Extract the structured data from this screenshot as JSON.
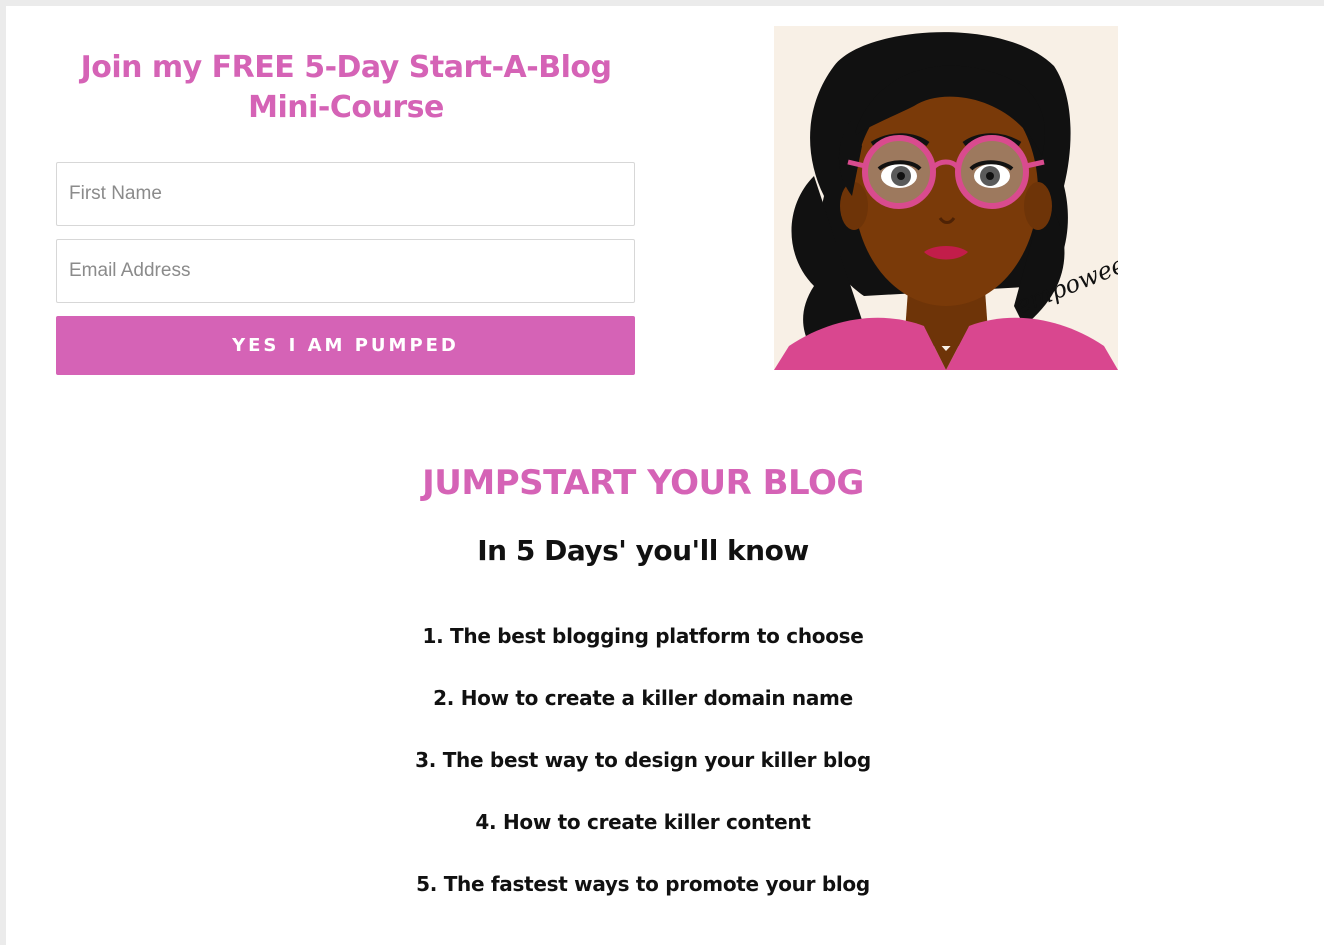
{
  "signup": {
    "title": "Join my FREE 5-Day Start-A-Blog Mini-Course",
    "first_name_placeholder": "First Name",
    "first_name_value": "",
    "email_placeholder": "Email Address",
    "email_value": "",
    "submit_label": "YES I AM PUMPED"
  },
  "avatar": {
    "signature": "empowee",
    "icon": "woman-with-pink-glasses-illustration"
  },
  "content": {
    "heading": "JUMPSTART YOUR BLOG",
    "subheading": "In 5 Days' you'll know",
    "items": [
      "1. The best blogging platform to choose",
      "2. How to create a killer domain name",
      "3. The best way to design your killer blog",
      "4. How to create killer content",
      "5. The fastest ways to promote your blog"
    ]
  },
  "colors": {
    "accent": "#d563b6",
    "text": "#111111",
    "page_background": "#ffffff",
    "outer_background": "#ebebeb"
  }
}
